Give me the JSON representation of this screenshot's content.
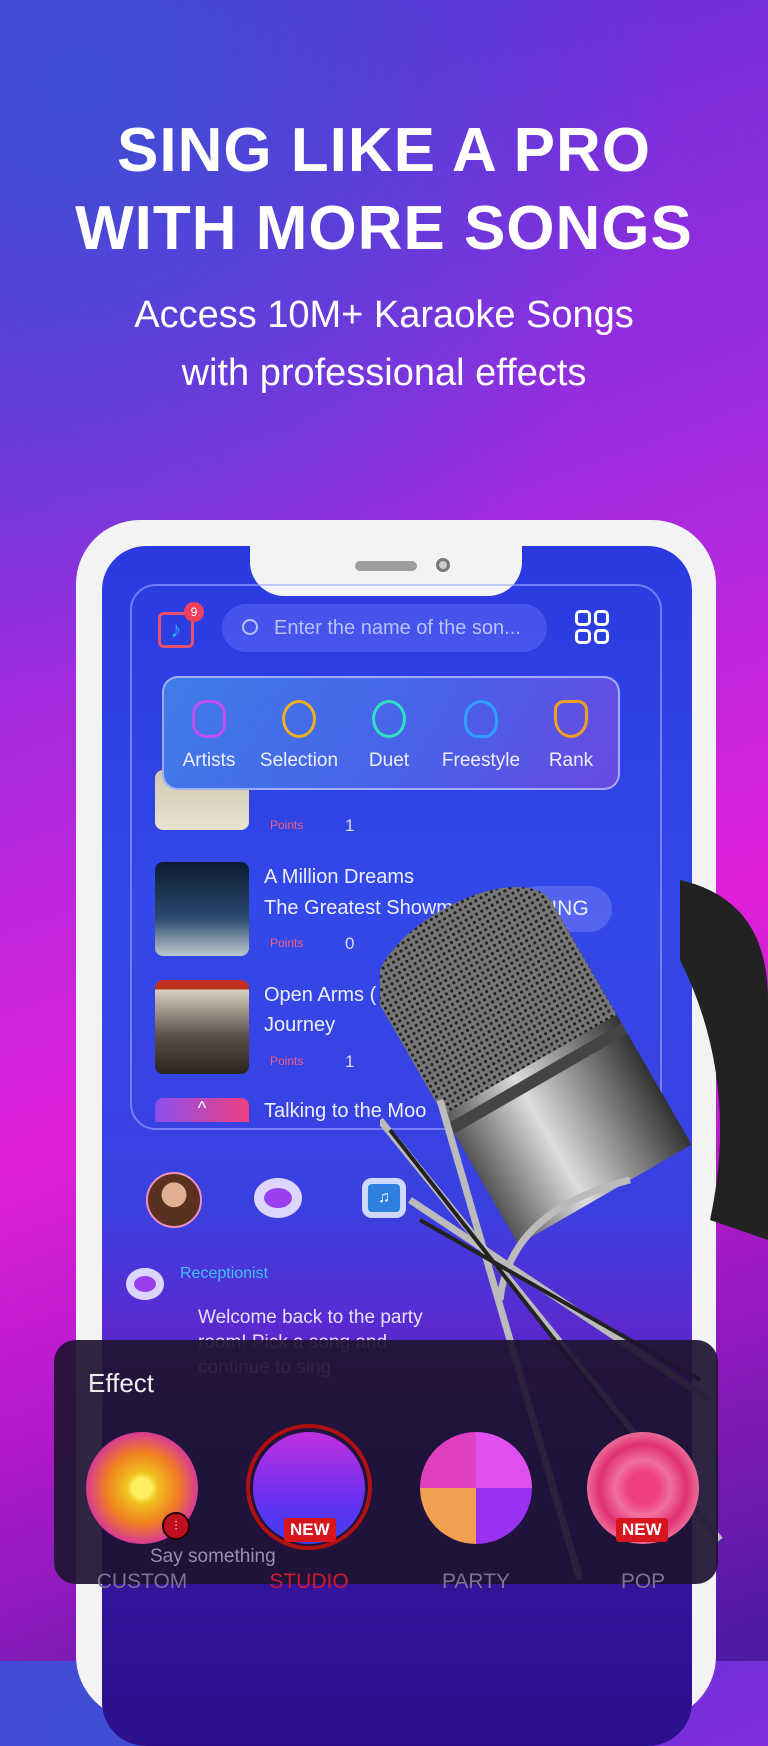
{
  "headline": {
    "line1": "SING LIKE A PRO",
    "line2": "WITH MORE SONGS"
  },
  "subtitle": {
    "line1": "Access 10M+ Karaoke Songs",
    "line2": "with professional effects"
  },
  "app": {
    "notification_count": "9",
    "search_placeholder": "Enter the name of the son...",
    "menu": [
      {
        "label": "Artists",
        "icon": "artist-icon",
        "color": "#c050f0"
      },
      {
        "label": "Selection",
        "icon": "medal-icon",
        "color": "#f0b020"
      },
      {
        "label": "Duet",
        "icon": "duet-hearts-icon",
        "color": "#30e0c0"
      },
      {
        "label": "Freestyle",
        "icon": "microphone-icon",
        "color": "#30a0ff"
      },
      {
        "label": "Rank",
        "icon": "trophy-icon",
        "color": "#f0a020"
      }
    ],
    "songs": [
      {
        "title": "",
        "artist": "",
        "points_label": "Points",
        "count": "1"
      },
      {
        "title": "A Million Dreams",
        "artist": "The Greatest Showman",
        "points_label": "Points",
        "count": "0",
        "action": "SING"
      },
      {
        "title": "Open Arms ( Sh",
        "artist": "Journey",
        "points_label": "Points",
        "count": "1"
      },
      {
        "title": "Talking to the Moo",
        "artist": ""
      }
    ],
    "chat": {
      "sender": "Receptionist",
      "message": "Welcome back to the party room! Pick a song and continue to sing",
      "input_placeholder": "Say something"
    },
    "effect": {
      "title": "Effect",
      "items": [
        {
          "label": "CUSTOM",
          "selected": false,
          "badge": ""
        },
        {
          "label": "STUDIO",
          "selected": true,
          "badge": "NEW"
        },
        {
          "label": "PARTY",
          "selected": false,
          "badge": ""
        },
        {
          "label": "POP",
          "selected": false,
          "badge": "NEW"
        }
      ],
      "accent": "#d8141c"
    }
  }
}
